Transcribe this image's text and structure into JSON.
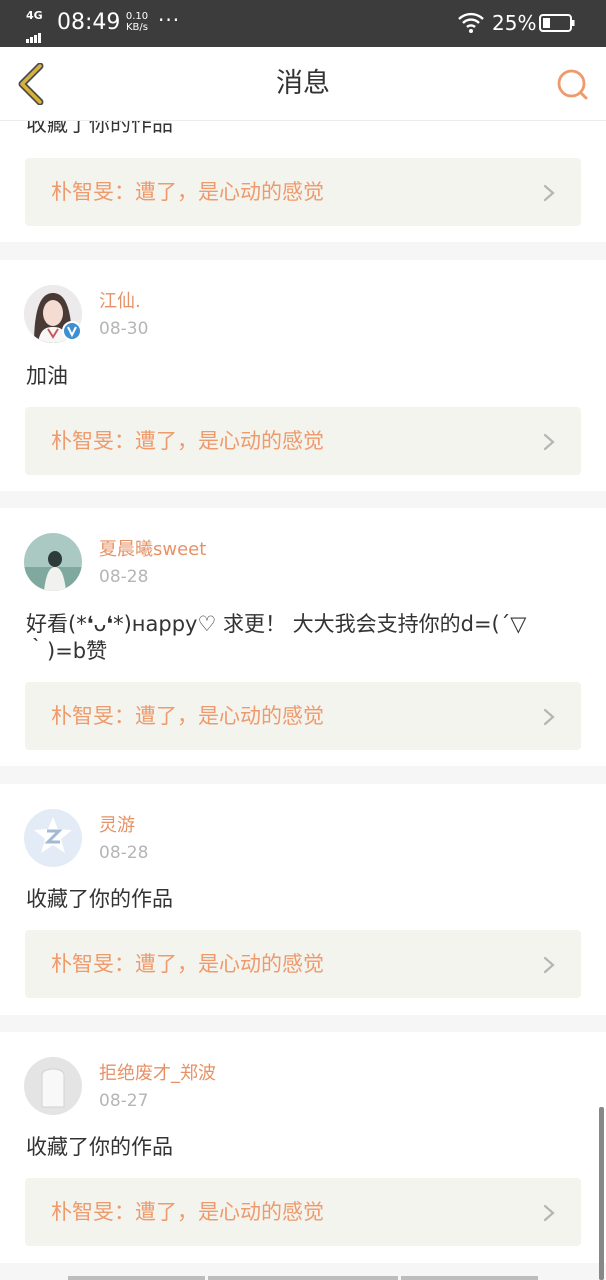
{
  "status_bar": {
    "network": "4G",
    "time": "08:49",
    "speed_value": "0.10",
    "speed_unit": "KB/s",
    "dots": "···",
    "battery": "25%"
  },
  "header": {
    "title": "消息",
    "back_icon": "chevron-left-icon",
    "search_icon": "search-icon"
  },
  "colors": {
    "accent": "#e79266",
    "work_text": "#ee9a6d",
    "work_bg": "#f4f4ee",
    "back_icon": "#d7b13a",
    "verified": "#3c8fd1"
  },
  "messages": [
    {
      "text": "收藏了你的作品",
      "work": "朴智旻：遭了，是心动的感觉"
    },
    {
      "user": "江仙.",
      "date": "08-30",
      "text": "加油",
      "verified": true,
      "work": "朴智旻：遭了，是心动的感觉"
    },
    {
      "user": "夏晨曦sweet",
      "date": "08-28",
      "text": "好看(*❛ᴗ❛*)нappy♡ 求更！ 大大我会支持你的d=(´▽｀)=b赞",
      "work": "朴智旻：遭了，是心动的感觉"
    },
    {
      "user": "灵游",
      "date": "08-28",
      "text": "收藏了你的作品",
      "work": "朴智旻：遭了，是心动的感觉"
    },
    {
      "user": "拒绝废才_郑波",
      "date": "08-27",
      "text": "收藏了你的作品",
      "work": "朴智旻：遭了，是心动的感觉"
    }
  ]
}
